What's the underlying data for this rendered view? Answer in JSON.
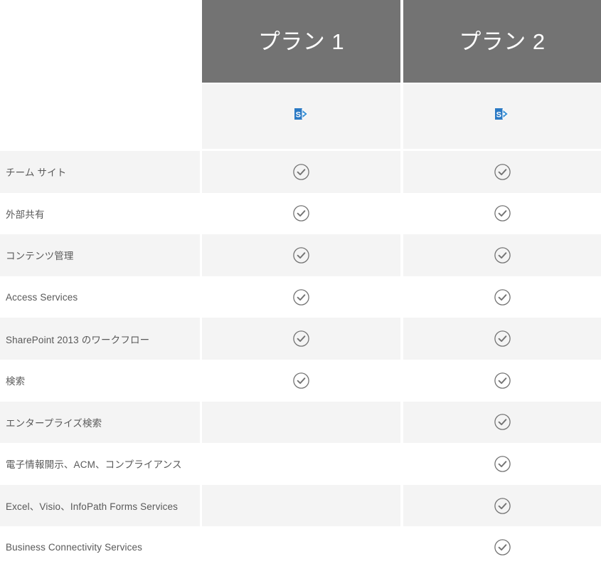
{
  "table": {
    "columns": [
      {
        "id": "features",
        "label": ""
      },
      {
        "id": "plan1",
        "label": "プラン 1",
        "product_icon": "sharepoint-logo-icon"
      },
      {
        "id": "plan2",
        "label": "プラン 2",
        "product_icon": "sharepoint-logo-icon"
      }
    ],
    "colors": {
      "header_background": "#737373",
      "header_text": "#ffffff",
      "row_shaded": "#f4f4f4",
      "row_plain": "#ffffff",
      "label_text": "#595959",
      "check_stroke": "#737373",
      "logo_blue": "#2a79c4",
      "logo_blue_light": "#3d93d6"
    },
    "check_glyph": "check-circle-icon",
    "rows": [
      {
        "label": "チーム サイト",
        "plan1": true,
        "plan2": true
      },
      {
        "label": "外部共有",
        "plan1": true,
        "plan2": true
      },
      {
        "label": "コンテンツ管理",
        "plan1": true,
        "plan2": true
      },
      {
        "label": "Access Services",
        "plan1": true,
        "plan2": true
      },
      {
        "label": "SharePoint 2013 のワークフロー",
        "plan1": true,
        "plan2": true
      },
      {
        "label": "検索",
        "plan1": true,
        "plan2": true
      },
      {
        "label": "エンタープライズ検索",
        "plan1": false,
        "plan2": true
      },
      {
        "label": "電子情報開示、ACM、コンプライアンス",
        "plan1": false,
        "plan2": true
      },
      {
        "label": "Excel、Visio、InfoPath Forms Services",
        "plan1": false,
        "plan2": true
      },
      {
        "label": "Business Connectivity Services",
        "plan1": false,
        "plan2": true
      }
    ]
  }
}
